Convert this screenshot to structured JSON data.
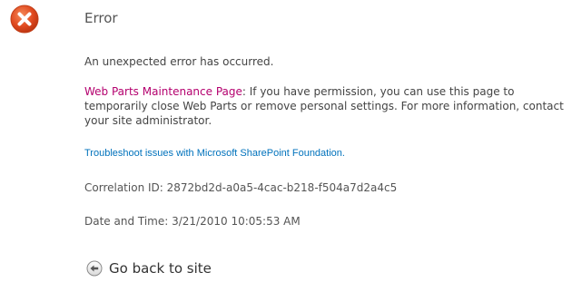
{
  "error": {
    "title": "Error",
    "message": "An unexpected error has occurred.",
    "maintenance_link_label": "Web Parts Maintenance Page",
    "maintenance_text": ": If you have permission, you can use this page to temporarily close Web Parts or remove personal settings. For more information, contact your site administrator.",
    "troubleshoot_link_label": "Troubleshoot issues with Microsoft SharePoint Foundation.",
    "correlation_id": "Correlation ID: 2872bd2d-a0a5-4cac-b218-f504a7d2a4c5",
    "date_time": "Date and Time: 3/21/2010 10:05:53 AM",
    "go_back_label": "Go back to site"
  },
  "icons": {
    "error": "error-x-circle-icon",
    "back": "back-arrow-circle-icon"
  },
  "colors": {
    "error_icon": "#e0491f",
    "maintenance_link": "#b4006e",
    "troubleshoot_link": "#0072bc"
  }
}
